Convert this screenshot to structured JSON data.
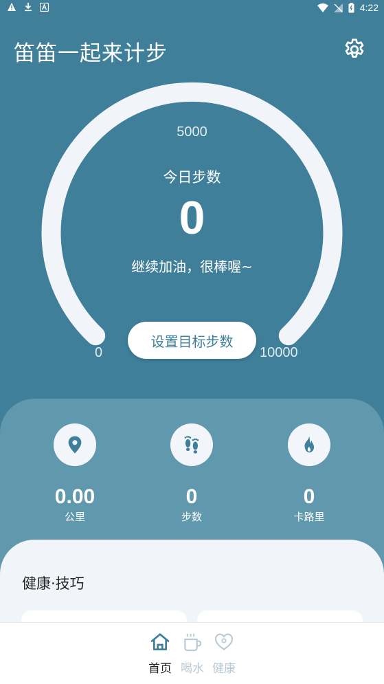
{
  "status_bar": {
    "time": "4:22"
  },
  "header": {
    "title": "笛笛一起来计步"
  },
  "gauge": {
    "mid_label": "5000",
    "min_label": "0",
    "max_label": "10000",
    "today_label": "今日步数",
    "steps": "0",
    "encourage": "继续加油，很棒喔~",
    "goal_button": "设置目标步数"
  },
  "stats": [
    {
      "icon": "location-pin-icon",
      "value": "0.00",
      "label": "公里"
    },
    {
      "icon": "footprints-icon",
      "value": "0",
      "label": "步数"
    },
    {
      "icon": "flame-icon",
      "value": "0",
      "label": "卡路里"
    }
  ],
  "health": {
    "title": "健康·技巧"
  },
  "nav": [
    {
      "label": "首页",
      "icon": "home-icon",
      "active": true
    },
    {
      "label": "喝水",
      "icon": "cup-icon",
      "active": false
    },
    {
      "label": "健康",
      "icon": "stethoscope-icon",
      "active": false
    }
  ],
  "colors": {
    "background": "#3f7f9a",
    "panel": "#6099ae",
    "card": "#f1f5f9",
    "accent": "#3f7f9a",
    "inactive": "#b9cad3"
  }
}
